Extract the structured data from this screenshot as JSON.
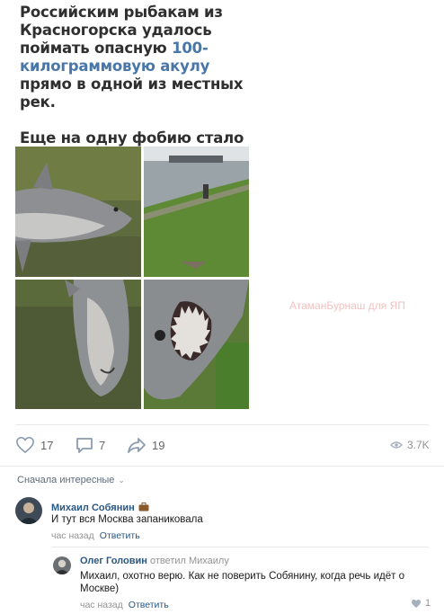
{
  "post": {
    "text_part1": "Российским рыбакам из Красногорска удалось поймать опасную ",
    "text_link": "100-килограммовую акулу",
    "text_part2": " прямо в одной из местных рек.",
    "text_paragraph2": "Еще на одну фобию стало больше."
  },
  "photos": [
    {
      "name": "shark-photo-side"
    },
    {
      "name": "river-bank-photo"
    },
    {
      "name": "shark-photo-belly"
    },
    {
      "name": "shark-photo-mouth"
    }
  ],
  "watermark": "АтаманБурнаш для ЯП",
  "actions": {
    "likes": "17",
    "comments": "7",
    "shares": "19",
    "views": "3.7K"
  },
  "comments_sort": {
    "label": "Сначала интересные"
  },
  "comments": [
    {
      "author": "Михаил Собянин",
      "badge_icon": "briefcase-icon",
      "text": "И тут вся Москва запаниковала",
      "time": "час назад",
      "reply_label": "Ответить"
    },
    {
      "author": "Олег Головин",
      "replied_to": "ответил Михаилу",
      "text": "Михаил, охотно верю. Как не поверить Собянину, когда речь идёт о Москве)",
      "time": "час назад",
      "reply_label": "Ответить",
      "likes": "1"
    }
  ],
  "colors": {
    "link": "#4a76a8",
    "author": "#2a5885",
    "muted": "#939393",
    "watermark": "#f2c1c1"
  }
}
